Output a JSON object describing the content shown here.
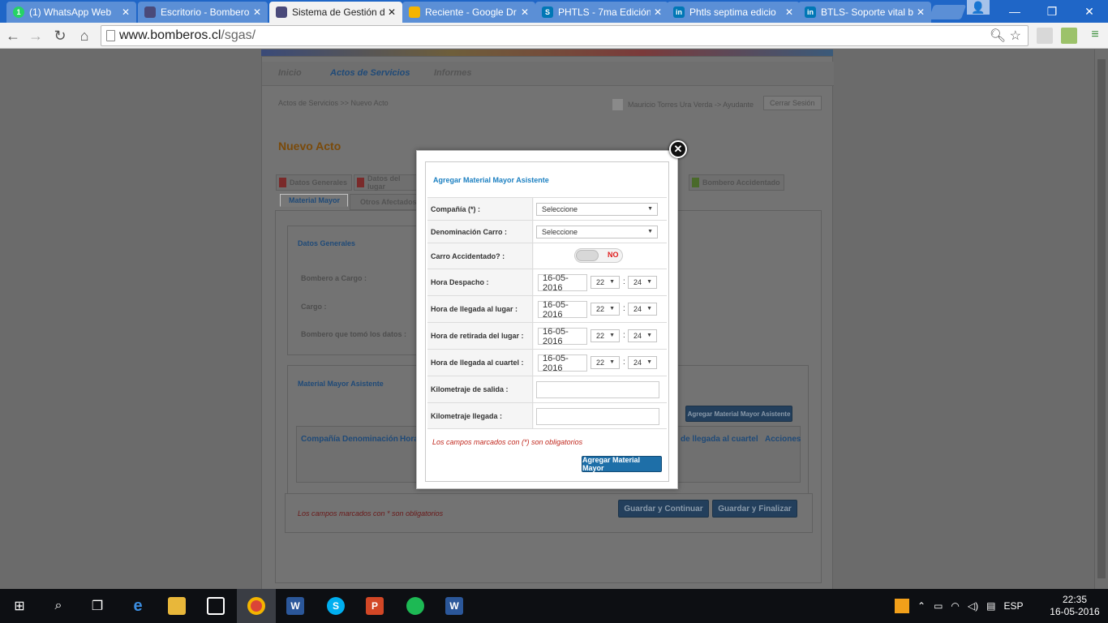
{
  "browser": {
    "tabs": [
      {
        "title": "(1) WhatsApp Web",
        "icon": "whatsapp-icon",
        "color": "#25d366",
        "badge": "1"
      },
      {
        "title": "Escritorio - Bomberos",
        "icon": "bomberos-shield-icon",
        "color": "#4a4a7a",
        "badge": ""
      },
      {
        "title": "Sistema de Gestión de",
        "icon": "bomberos-shield-icon",
        "color": "#4a4a7a",
        "badge": ""
      },
      {
        "title": "Reciente - Google Dr",
        "icon": "google-drive-icon",
        "color": "#f4b400",
        "badge": ""
      },
      {
        "title": "PHTLS - 7ma Edición",
        "icon": "slideshare-icon",
        "color": "#0077b5",
        "badge": "S"
      },
      {
        "title": "Phtls septima edicio",
        "icon": "linkedin-icon",
        "color": "#0077b5",
        "badge": "in"
      },
      {
        "title": "BTLS- Soporte vital b",
        "icon": "linkedin-icon",
        "color": "#0077b5",
        "badge": "in"
      }
    ],
    "url_host": "www.bomberos.cl",
    "url_path": "/sgas/"
  },
  "page": {
    "menu": [
      "Inicio",
      "Actos de Servicios",
      "Informes"
    ],
    "breadcrumb": "Actos de Servicios >> Nuevo Acto",
    "user": "Mauricio Torres Ura Verda -> Ayudante",
    "logout": "Cerrar Sesión",
    "heading": "Nuevo Acto",
    "tabs_row1": [
      "Datos Generales",
      "Datos del lugar",
      "Bombero Accidentado"
    ],
    "tabs_row2": [
      "Material Mayor",
      "Otros Afectados"
    ],
    "panel_general_title": "Datos Generales",
    "general_labels": [
      "Bombero a Cargo :",
      "Cargo :",
      "Bombero que tomó los datos :"
    ],
    "panel_material_title": "Material Mayor Asistente",
    "add_material_btn": "Agregar Material Mayor Asistente",
    "table_headers": [
      "Compañía",
      "Denominación",
      "Hora",
      "de llegada al cuartel",
      "Acciones"
    ],
    "required_note": "Los campos marcados con * son obligatorios",
    "save_continue": "Guardar y Continuar",
    "save_finish": "Guardar y Finalizar"
  },
  "modal": {
    "title": "Agregar Material Mayor Asistente",
    "fields": {
      "compania_label": "Compañía (*) :",
      "compania_value": "Seleccione",
      "denominacion_label": "Denominación Carro :",
      "denominacion_value": "Seleccione",
      "accidentado_label": "Carro Accidentado? :",
      "accidentado_value": "NO",
      "despacho_label": "Hora Despacho :",
      "llegada_lugar_label": "Hora de llegada al lugar :",
      "retirada_label": "Hora de retirada del lugar :",
      "llegada_cuartel_label": "Hora de llegada al cuartel :",
      "km_salida_label": "Kilometraje de salida :",
      "km_llegada_label": "Kilometraje llegada :",
      "date": "16-05-2016",
      "hour": "22",
      "minute": "24",
      "colon": ":"
    },
    "required_note": "Los campos marcados con (*) son obligatorios",
    "submit": "Agregar Material Mayor"
  },
  "taskbar": {
    "lang": "ESP",
    "time": "22:35",
    "date": "16-05-2016"
  }
}
